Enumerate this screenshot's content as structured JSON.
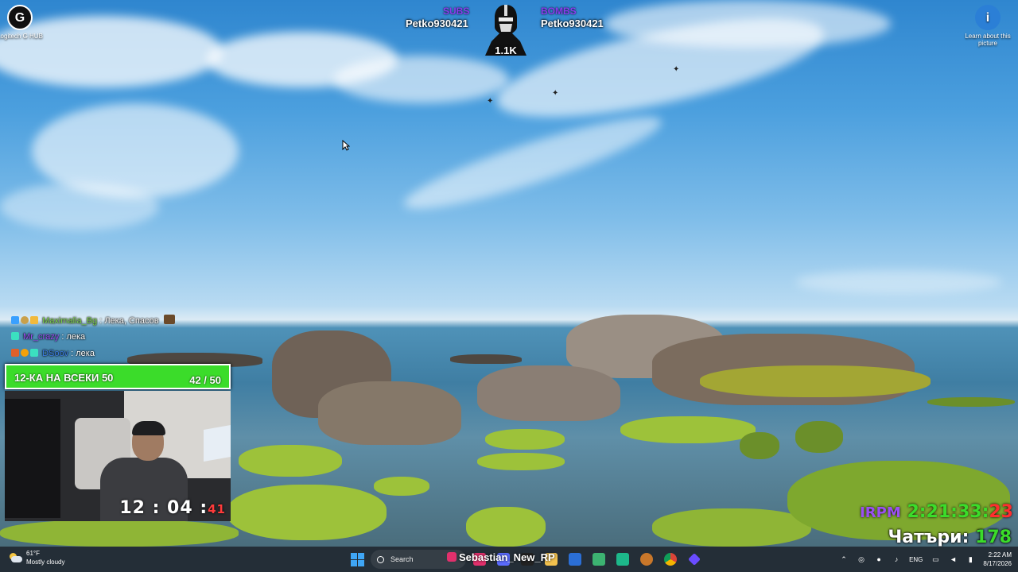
{
  "desktop": {
    "icons": [
      {
        "label": "Logitech G HUB",
        "glyph": "G",
        "icon": "logitech-g-hub-icon"
      },
      {
        "label": "Learn about this picture",
        "glyph": "i",
        "icon": "info-icon"
      }
    ]
  },
  "overlay": {
    "subs_label": "SUBS",
    "subs_name": "Petko930421",
    "bombs_label": "BOMBS",
    "bombs_name": "Petko930421",
    "mascot_count": "1.1K"
  },
  "chat": [
    {
      "user": "Maximalia_Bg",
      "message": ": Лека, Спасов"
    },
    {
      "user": "Mr_crazy",
      "message": ": лека"
    },
    {
      "user": "DSoov",
      "message": ": лека"
    }
  ],
  "goal": {
    "title": "12-КА НА ВСЕКИ 50",
    "count": "42 / 50",
    "progress": 0.84
  },
  "webcam": {
    "timer_main": "12 : 04 :",
    "timer_sec": "41"
  },
  "rpm": {
    "label": "IRPM",
    "time": "2:21:33:",
    "sec": "23"
  },
  "umbrellas": {
    "label": "Чатъри:",
    "value": "178"
  },
  "taskbar": {
    "weather_temp": "61°F",
    "weather_desc": "Mostly cloudy",
    "search_placeholder": "Search",
    "stream_name": "Sebastian_New_RP",
    "language": "ENG",
    "time": "2:22 AM",
    "date": "8/17/2026"
  }
}
